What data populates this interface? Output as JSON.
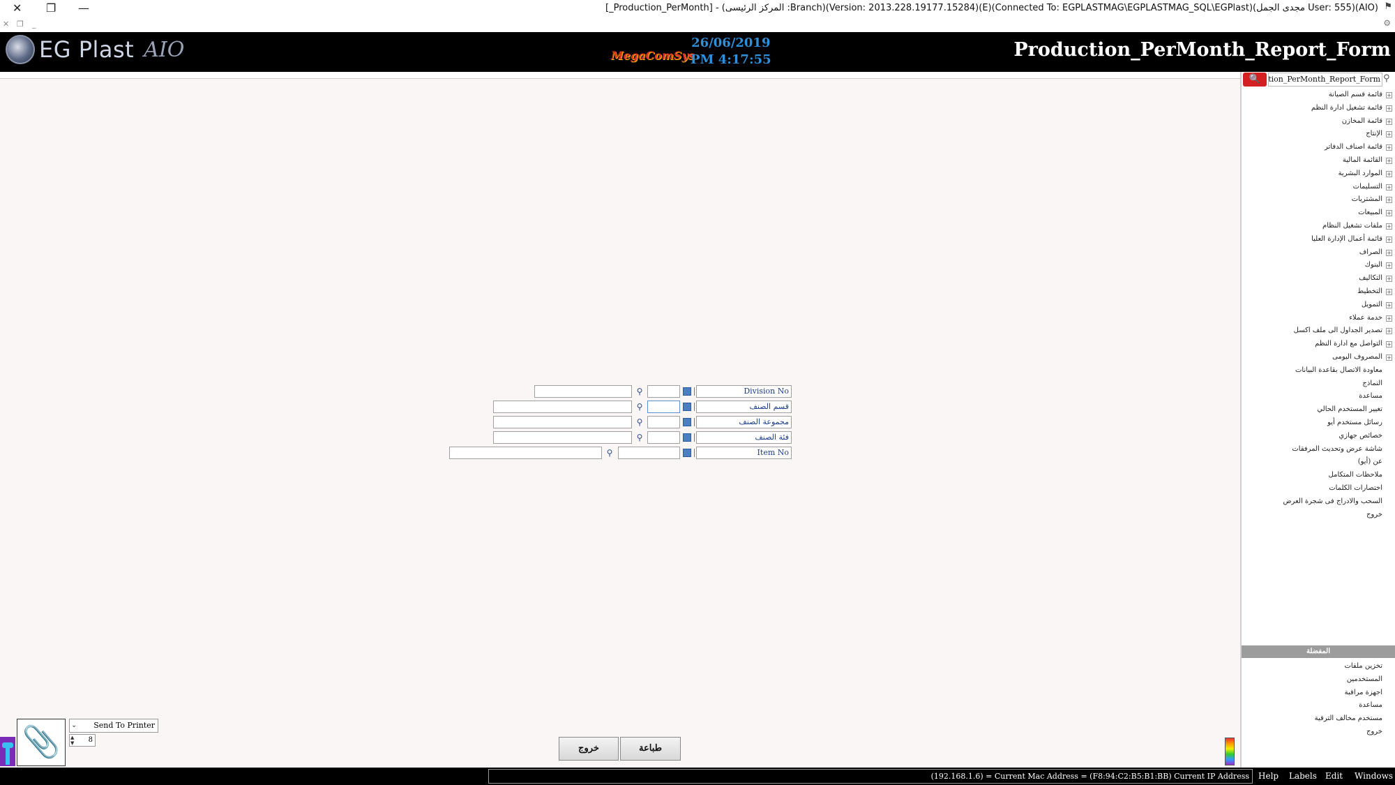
{
  "window": {
    "title": "[_Production_PerMonth] - (المركز الرئيسى :Branch)(Version: 2013.228.19177.15284)(E)(Connected To: EGPLASTMAG\\EGPLASTMAG_SQL\\EGPlast)(مجدى الجمل User: 555)(AIO)",
    "close_glyph": "✕",
    "restore_glyph": "❐",
    "min_glyph": "—"
  },
  "header": {
    "app_name": "EG Plast",
    "app_suffix": "AIO",
    "brand": "MegaComSys",
    "date": "26/06/2019",
    "time": "PM 4:17:55",
    "form_title": "Production_PerMonth_Report_Form"
  },
  "sidebar": {
    "search_value": "Production_PerMonth_Report_Form",
    "tree": [
      "قائمة قسم الصيانة",
      "قائمة تشغيل ادارة النظم",
      "قائمة المخازن",
      "الإنتاج",
      "قائمة اصناف الدفاتر",
      "القائمة المالية",
      "الموارد البشرية",
      "التسليمات",
      "المشتريات",
      "المبيعات",
      "ملفات تشغيل النظام",
      "قائمة أعمال الإدارة العليا",
      "الصراف",
      "البنوك",
      "التكاليف",
      "التخطيط",
      "التمويل",
      "خدمة عملاء",
      "تصدير الجداول الى ملف اكسل",
      "التواصل مع ادارة النظم",
      "المصروف اليومى"
    ],
    "leaves": [
      "معاودة الاتصال بقاعدة البيانات",
      "النماذج",
      "مساعدة",
      "تغيير المستخدم الحالي",
      "رسائل مستخدم أيو",
      "خصائص جهازي",
      "شاشة عرض وتحديث المرفقات",
      "عن (أيو)",
      "ملاحظات المتكامل",
      "اختصارات الكلمات",
      "السحب والادراج فى شجرة العرض",
      "خروج"
    ],
    "favorites_header": "المفضلة",
    "favorites": [
      "تخزين ملفات",
      "المستخدمين",
      "اجهزة مراقبة",
      "مساعدة",
      "مستخدم مخالف الترقية",
      "خروج"
    ]
  },
  "form": {
    "division_label": "Division No",
    "category_label": "قسم الصنف",
    "group_label": "مجموعة الصنف",
    "class_label": "فئة الصنف",
    "item_label": "Item No"
  },
  "bottom": {
    "print_target": "Send To Printer",
    "copies": "8",
    "exit_button": "خروج",
    "print_button": "طباعة"
  },
  "status": {
    "text": "(192.168.1.6) = Current Mac Address = (F8:94:C2:B5:B1:BB) Current IP Address",
    "menus": [
      "Help",
      "Labels",
      "Edit",
      "Windows"
    ]
  }
}
